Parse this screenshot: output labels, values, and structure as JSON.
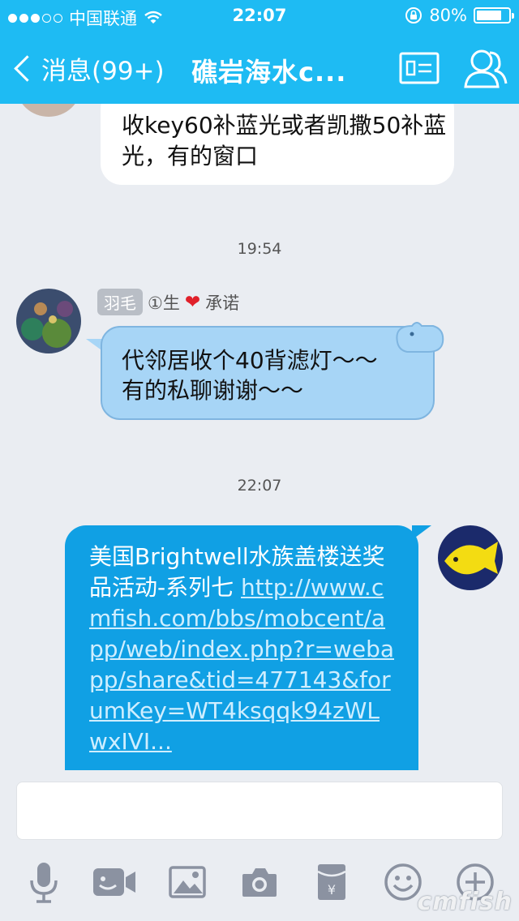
{
  "status_bar": {
    "carrier": "中国联通",
    "time": "22:07",
    "battery_percent": "80%",
    "battery_level": 0.8
  },
  "nav": {
    "back_label": "消息(99+)",
    "title": "礁岩海水c..."
  },
  "messages": [
    {
      "type": "text",
      "side": "left",
      "text": "收key60补蓝光或者凯撒50补蓝光，有的窗口"
    },
    {
      "type": "time",
      "text": "19:54"
    },
    {
      "type": "text",
      "side": "left",
      "sender_tag": "羽毛",
      "sender_name": "①生",
      "sender_suffix": "承诺",
      "text_line1": "代邻居收个40背滤灯～～",
      "text_line2": "有的私聊谢谢～～"
    },
    {
      "type": "time",
      "text": "22:07"
    },
    {
      "type": "text",
      "side": "right",
      "text": "美国Brightwell水族盖楼送奖品活动-系列七",
      "link": "http://www.cmfish.com/bbs/mobcent/app/web/index.php?r=webapp/share&tid=477143&forumKey=WT4ksqqk94zWLwxIVI..."
    }
  ],
  "input": {
    "placeholder": ""
  },
  "toolbar": [
    "microphone-icon",
    "video-icon",
    "image-icon",
    "camera-icon",
    "red-packet-icon",
    "emoji-icon",
    "plus-icon"
  ],
  "watermark": "cmfish",
  "colors": {
    "accent": "#1ebbf3",
    "mine_bubble": "#10a0e4",
    "peer_bubble": "#a7d5f6"
  }
}
